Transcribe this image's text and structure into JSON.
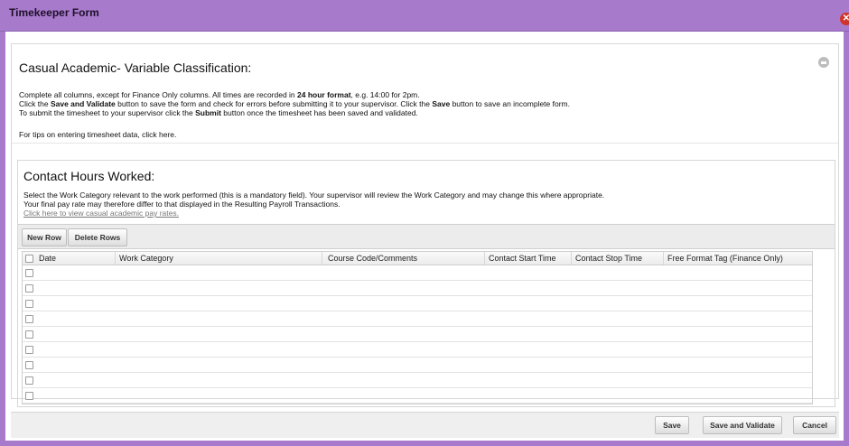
{
  "window": {
    "title": "Timekeeper Form",
    "accent_color": "#a77acb",
    "close_color": "#d0342c"
  },
  "content": {
    "heading": "Casual Academic- Variable Classification:",
    "instructions": {
      "l1a": "Complete all columns, except for Finance Only columns. All times are recorded in ",
      "l1b": "24 hour format",
      "l1c": ", e.g. 14:00 for 2pm.",
      "l2a": "Click the ",
      "l2b": "Save and Validate",
      "l2c": " button to save the form and check for errors before submitting it to your supervisor. Click the ",
      "l2d": "Save",
      "l2e": " button to save an incomplete form.",
      "l3a": "To submit the timesheet to your supervisor click the ",
      "l3b": "Submit",
      "l3c": " button once the timesheet has been saved and validated.",
      "tips": "For tips on entering timesheet data, click here."
    }
  },
  "contact": {
    "title": "Contact Hours Worked:",
    "desc1": "Select the Work Category relevant to the work performed (this is a mandatory field). Your supervisor will review the Work Category and may change this where appropriate.",
    "desc2": "Your final pay rate may therefore differ to that displayed in the Resulting Payroll Transactions.",
    "link": "Click here to view casual academic pay rates",
    "link_suffix": ".",
    "toolbar": {
      "new_row": "New Row",
      "delete_rows": "Delete Rows"
    },
    "columns": {
      "date": "Date",
      "work_category": "Work Category",
      "course_code": "Course Code/Comments",
      "start": "Contact Start Time",
      "stop": "Contact Stop Time",
      "tag": "Free Format Tag (Finance Only)"
    }
  },
  "footer": {
    "save": "Save",
    "save_validate": "Save and Validate",
    "cancel": "Cancel"
  }
}
